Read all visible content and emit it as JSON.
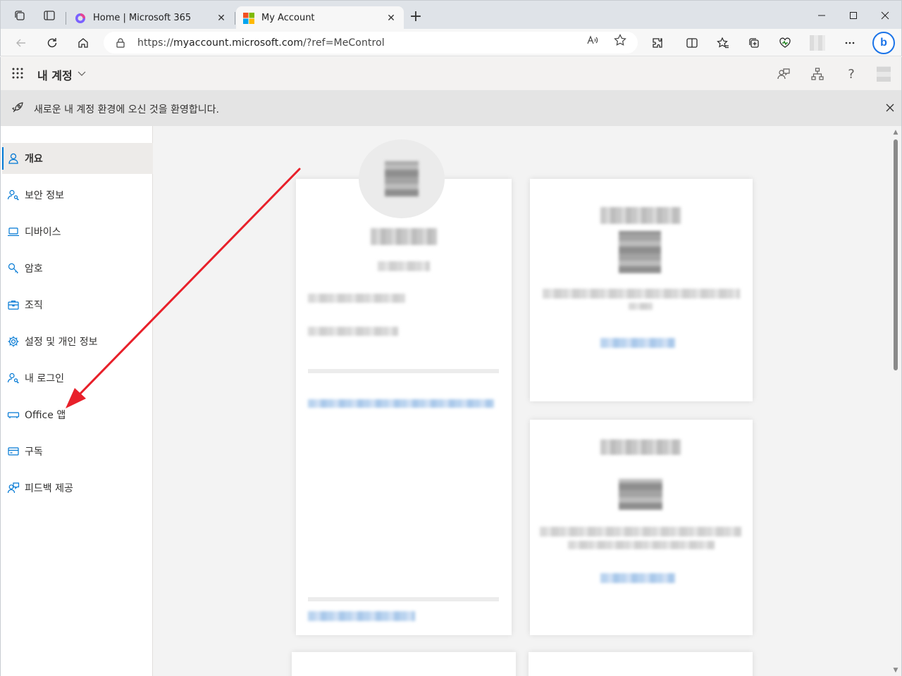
{
  "browser": {
    "tabs": [
      {
        "title": "Home | Microsoft 365",
        "active": false,
        "favicon": "microsoft365-icon"
      },
      {
        "title": "My Account",
        "active": true,
        "favicon": "microsoft-logo-icon"
      }
    ],
    "address": {
      "url_prefix": "https://",
      "url_host": "myaccount.microsoft.com",
      "url_path": "/?ref=MeControl"
    },
    "bing_label": "b"
  },
  "app": {
    "title": "내 계정"
  },
  "banner": {
    "text": "새로운 내 계정 환경에 오신 것을 환영합니다."
  },
  "sidebar": {
    "items": [
      {
        "label": "개요",
        "icon": "person-icon",
        "selected": true
      },
      {
        "label": "보안 정보",
        "icon": "person-key-icon",
        "selected": false
      },
      {
        "label": "디바이스",
        "icon": "laptop-icon",
        "selected": false
      },
      {
        "label": "암호",
        "icon": "key-icon",
        "selected": false
      },
      {
        "label": "조직",
        "icon": "briefcase-icon",
        "selected": false
      },
      {
        "label": "설정 및 개인 정보",
        "icon": "gear-icon",
        "selected": false
      },
      {
        "label": "내 로그인",
        "icon": "person-key-icon",
        "selected": false
      },
      {
        "label": "Office 앱",
        "icon": "office-app-icon",
        "selected": false
      },
      {
        "label": "구독",
        "icon": "credit-card-icon",
        "selected": false
      },
      {
        "label": "피드백 제공",
        "icon": "feedback-icon",
        "selected": false
      }
    ]
  },
  "colors": {
    "accent": "#0078d4",
    "annotation_arrow": "#e8202a"
  }
}
